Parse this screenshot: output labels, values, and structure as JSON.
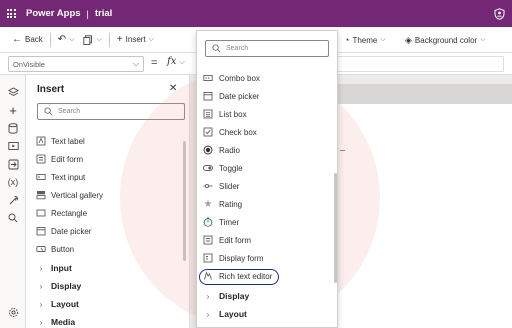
{
  "titlebar": {
    "app_name": "Power Apps",
    "separator": "|",
    "environment": "trial",
    "right_icon": "shield-person-icon"
  },
  "toolbar": {
    "back_label": "Back",
    "insert_label": "Insert",
    "theme_label": "Theme",
    "background_color_label": "Background color"
  },
  "formula_bar": {
    "property": "OnVisible",
    "equals": "=",
    "fx": "fx"
  },
  "insert_pane": {
    "title": "Insert",
    "search_placeholder": "Search",
    "items": [
      {
        "label": "Text label",
        "icon": "text-label-icon"
      },
      {
        "label": "Edit form",
        "icon": "edit-form-icon"
      },
      {
        "label": "Text input",
        "icon": "text-input-icon"
      },
      {
        "label": "Vertical gallery",
        "icon": "gallery-icon"
      },
      {
        "label": "Rectangle",
        "icon": "rectangle-icon"
      },
      {
        "label": "Date picker",
        "icon": "calendar-icon"
      },
      {
        "label": "Button",
        "icon": "button-icon"
      }
    ],
    "groups": [
      {
        "label": "Input"
      },
      {
        "label": "Display"
      },
      {
        "label": "Layout"
      },
      {
        "label": "Media"
      }
    ]
  },
  "insert_menu": {
    "search_placeholder": "Search",
    "items": [
      {
        "label": "Combo box",
        "icon": "combo-box-icon"
      },
      {
        "label": "Date picker",
        "icon": "calendar-icon"
      },
      {
        "label": "List box",
        "icon": "list-box-icon"
      },
      {
        "label": "Check box",
        "icon": "checkbox-icon"
      },
      {
        "label": "Radio",
        "icon": "radio-icon"
      },
      {
        "label": "Toggle",
        "icon": "toggle-icon"
      },
      {
        "label": "Slider",
        "icon": "slider-icon"
      },
      {
        "label": "Rating",
        "icon": "star-icon"
      },
      {
        "label": "Timer",
        "icon": "timer-icon"
      },
      {
        "label": "Edit form",
        "icon": "edit-form-icon"
      },
      {
        "label": "Display form",
        "icon": "display-form-icon"
      },
      {
        "label": "Rich text editor",
        "icon": "rich-text-icon"
      }
    ],
    "groups": [
      {
        "label": "Display"
      },
      {
        "label": "Layout"
      }
    ],
    "highlight_color": "#1f2b8a"
  },
  "colors": {
    "brand": "#742774",
    "accent": "#1f2b8a"
  }
}
